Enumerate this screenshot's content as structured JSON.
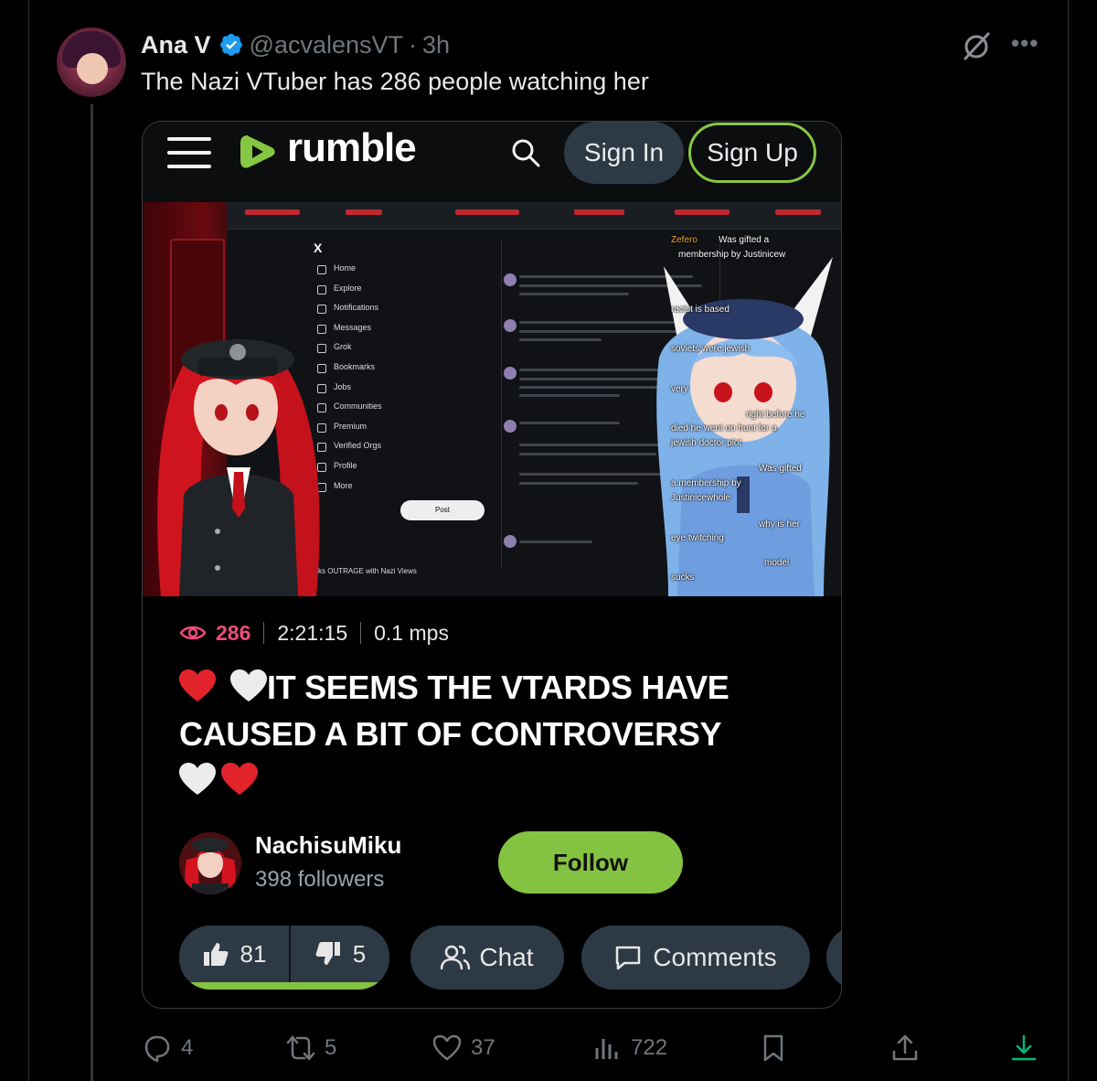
{
  "tweet": {
    "author_name": "Ana V",
    "handle": "@acvalensVT",
    "separator": "·",
    "time": "3h",
    "text": "The Nazi VTuber has 286 people watching her"
  },
  "rumble": {
    "logo_text": "rumble",
    "sign_in": "Sign In",
    "sign_up": "Sign Up",
    "brand_green": "#85c742",
    "video": {
      "views": "286",
      "duration": "2:21:15",
      "rate": "0.1 mps",
      "title_line": "IT SEEMS THE VTARDS HAVE CAUSED A BIT OF CONTROVERSY",
      "screen_nav": [
        "Home",
        "Explore",
        "Notifications",
        "Messages",
        "Grok",
        "Bookmarks",
        "Jobs",
        "Communities",
        "Premium",
        "Verified Orgs",
        "Profile",
        "More"
      ],
      "screen_post_button": "Post",
      "screen_bottom_title": "ks OUTRAGE with Nazi Views",
      "chat_overlay": [
        "Zefero",
        "Was gifted a",
        "membership by Justinicew",
        "racist is based",
        "soviets were jewish",
        "very",
        "right before he",
        "died he went on hunt for a",
        "jewish doctor plot",
        "Was gifted",
        "a membership by",
        "Justinicewhole",
        "why is her",
        "eye twitching",
        "model",
        "sucks"
      ]
    },
    "channel": {
      "name": "NachisuMiku",
      "followers": "398 followers",
      "follow_label": "Follow"
    },
    "buttons": {
      "likes": "81",
      "dislikes": "5",
      "chat": "Chat",
      "comments": "Comments"
    }
  },
  "tweet_actions": {
    "replies": "4",
    "retweets": "5",
    "likes": "37",
    "views": "722"
  },
  "colors": {
    "background": "#000000",
    "rumble_pill": "#2e3946",
    "views_pink": "#ee4b78",
    "verified_blue": "#1d9bf0",
    "share_green": "#00ba7c"
  }
}
